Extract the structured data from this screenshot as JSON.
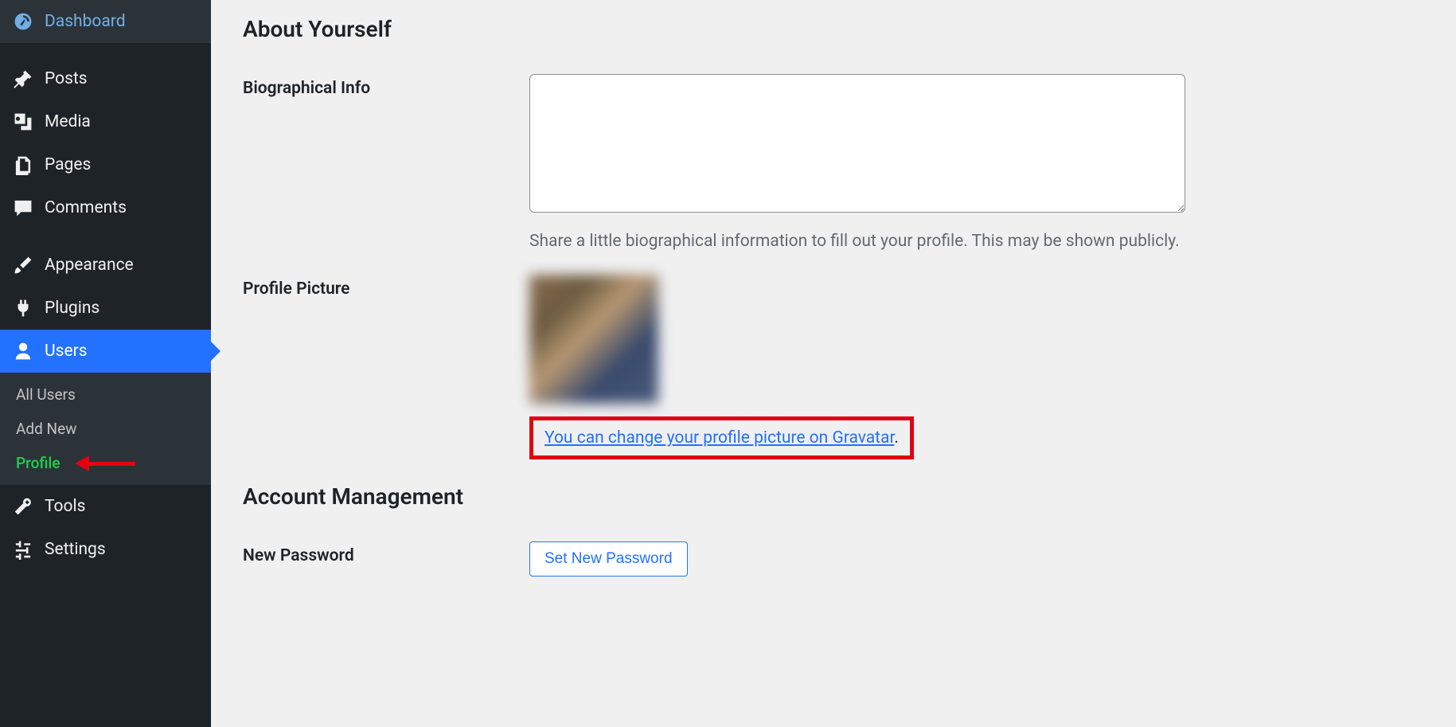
{
  "sidebar": {
    "items": [
      {
        "label": "Dashboard",
        "name": "dashboard",
        "icon": "dashboard-icon"
      },
      {
        "label": "Posts",
        "name": "posts",
        "icon": "pin-icon"
      },
      {
        "label": "Media",
        "name": "media",
        "icon": "media-icon"
      },
      {
        "label": "Pages",
        "name": "pages",
        "icon": "pages-icon"
      },
      {
        "label": "Comments",
        "name": "comments",
        "icon": "comment-icon"
      },
      {
        "label": "Appearance",
        "name": "appearance",
        "icon": "brush-icon"
      },
      {
        "label": "Plugins",
        "name": "plugins",
        "icon": "plug-icon"
      },
      {
        "label": "Users",
        "name": "users",
        "icon": "user-icon",
        "active": true
      },
      {
        "label": "Tools",
        "name": "tools",
        "icon": "wrench-icon"
      },
      {
        "label": "Settings",
        "name": "settings",
        "icon": "sliders-icon"
      }
    ],
    "submenu": {
      "items": [
        {
          "label": "All Users",
          "name": "all-users"
        },
        {
          "label": "Add New",
          "name": "add-new"
        },
        {
          "label": "Profile",
          "name": "profile",
          "current": true
        }
      ]
    }
  },
  "main": {
    "about_section_title": "About Yourself",
    "bio_label": "Biographical Info",
    "bio_value": "",
    "bio_description": "Share a little biographical information to fill out your profile. This may be shown publicly.",
    "profile_picture_label": "Profile Picture",
    "gravatar_link_text": "You can change your profile picture on Gravatar",
    "gravatar_period": ".",
    "account_section_title": "Account Management",
    "new_password_label": "New Password",
    "new_password_button": "Set New Password"
  }
}
